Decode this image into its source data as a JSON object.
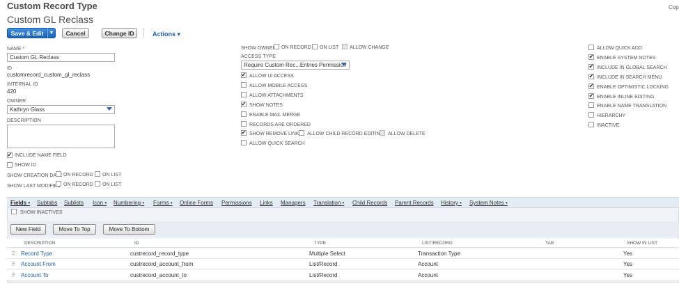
{
  "page": {
    "title": "Custom Record Type",
    "subtitle": "Custom GL Reclass",
    "corner_text": "Cop"
  },
  "toolbar": {
    "save_label": "Save & Edit",
    "split_arrow": "▼",
    "cancel_label": "Cancel",
    "change_id_label": "Change ID",
    "actions_label": "Actions ▾"
  },
  "form": {
    "name_label": "NAME",
    "required_mark": "*",
    "name_value": "Custom GL Reclass",
    "id_label": "ID",
    "id_value": "customrecord_custom_gl_reclass",
    "internal_id_label": "INTERNAL ID",
    "internal_id_value": "420",
    "owner_label": "OWNER",
    "owner_value": "Kathryn Glass",
    "description_label": "DESCRIPTION",
    "include_name_field": "INCLUDE NAME FIELD",
    "show_id": "SHOW ID",
    "show_creation_date": "SHOW CREATION DATE",
    "show_last_modified": "SHOW LAST MODIFIED",
    "on_record": "ON RECORD",
    "on_list": "ON LIST"
  },
  "middle": {
    "show_owner": "SHOW OWNER",
    "on_record": "ON RECORD",
    "on_list": "ON LIST",
    "allow_change": "ALLOW CHANGE",
    "access_type_label": "ACCESS TYPE",
    "access_type_value": "Require Custom Rec...Entries Permission",
    "allow_ui_access": "ALLOW UI ACCESS",
    "allow_mobile_access": "ALLOW MOBILE ACCESS",
    "allow_attachments": "ALLOW ATTACHMENTS",
    "show_notes": "SHOW NOTES",
    "enable_mail_merge": "ENABLE MAIL MERGE",
    "records_are_ordered": "RECORDS ARE ORDERED",
    "show_remove_link": "SHOW REMOVE LINK",
    "allow_child_record_editing": "ALLOW CHILD RECORD EDITING",
    "allow_delete": "ALLOW DELETE",
    "allow_quick_search": "ALLOW QUICK SEARCH"
  },
  "right": {
    "allow_quick_add": "ALLOW QUICK ADD",
    "enable_system_notes": "ENABLE SYSTEM NOTES",
    "include_in_global_search": "INCLUDE IN GLOBAL SEARCH",
    "include_in_search_menu": "INCLUDE IN SEARCH MENU",
    "enable_optimistic_locking": "ENABLE OPTIMISTIC LOCKING",
    "enable_inline_editing": "ENABLE INLINE EDITING",
    "enable_name_translation": "ENABLE NAME TRANSLATION",
    "hierarchy": "HIERARCHY",
    "inactive": "INACTIVE"
  },
  "tabs": [
    "Fields •",
    "Subtabs",
    "Sublists",
    "Icon •",
    "Numbering •",
    "Forms •",
    "Online Forms",
    "Permissions",
    "Links",
    "Managers",
    "Translation •",
    "Child Records",
    "Parent Records",
    "History •",
    "System Notes •"
  ],
  "sublist": {
    "show_inactives": "SHOW INACTIVES",
    "new_field": "New Field",
    "move_to_top": "Move To Top",
    "move_to_bottom": "Move To Bottom",
    "grip": "⠿",
    "columns": [
      "DESCRIPTION",
      "ID",
      "TYPE",
      "LIST/RECORD",
      "TAB",
      "SHOW IN LIST"
    ],
    "rows": [
      [
        "Record Type",
        "custrecord_record_type",
        "Multiple Select",
        "Transaction Type",
        "",
        "Yes"
      ],
      [
        "Account From",
        "custrecord_account_from",
        "List/Record",
        "Account",
        "",
        "Yes"
      ],
      [
        "Account To",
        "custrecord_account_to",
        "List/Record",
        "Account",
        "",
        "Yes"
      ]
    ]
  }
}
